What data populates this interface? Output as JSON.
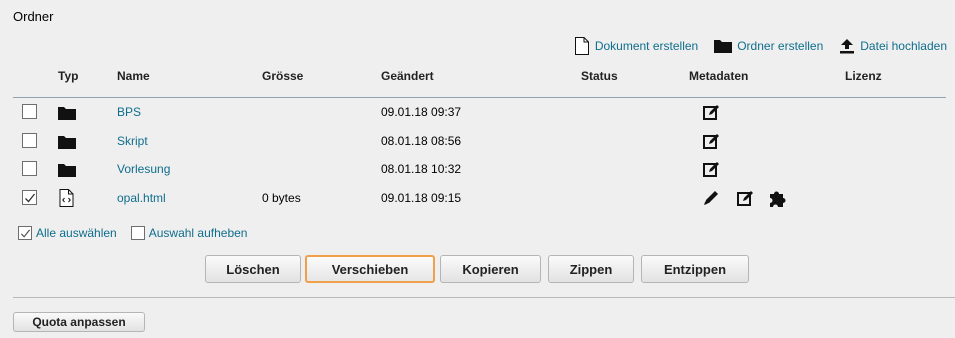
{
  "section_title": "Ordner",
  "toolbar": {
    "create_document": "Dokument erstellen",
    "create_folder": "Ordner erstellen",
    "upload_file": "Datei hochladen"
  },
  "columns": {
    "type": "Typ",
    "name": "Name",
    "size": "Grösse",
    "modified": "Geändert",
    "status": "Status",
    "metadata": "Metadaten",
    "license": "Lizenz"
  },
  "rows": [
    {
      "type": "folder-icon",
      "name": "BPS",
      "size": "",
      "modified": "09.01.18 09:37",
      "checked": false
    },
    {
      "type": "folder-icon",
      "name": "Skript",
      "size": "",
      "modified": "08.01.18 08:56",
      "checked": false
    },
    {
      "type": "folder-icon",
      "name": "Vorlesung",
      "size": "",
      "modified": "08.01.18 10:32",
      "checked": false
    },
    {
      "type": "html-file-icon",
      "name": "opal.html",
      "size": "0 bytes",
      "modified": "09.01.18 09:15",
      "checked": true
    }
  ],
  "selection": {
    "select_all": "Alle auswählen",
    "deselect": "Auswahl aufheben"
  },
  "actions": {
    "delete": "Löschen",
    "move": "Verschieben",
    "copy": "Kopieren",
    "zip": "Zippen",
    "unzip": "Entzippen"
  },
  "quota_button": "Quota anpassen",
  "colors": {
    "link": "#0f6e8c",
    "focus_border": "#f0a04b",
    "background": "#efefef"
  }
}
